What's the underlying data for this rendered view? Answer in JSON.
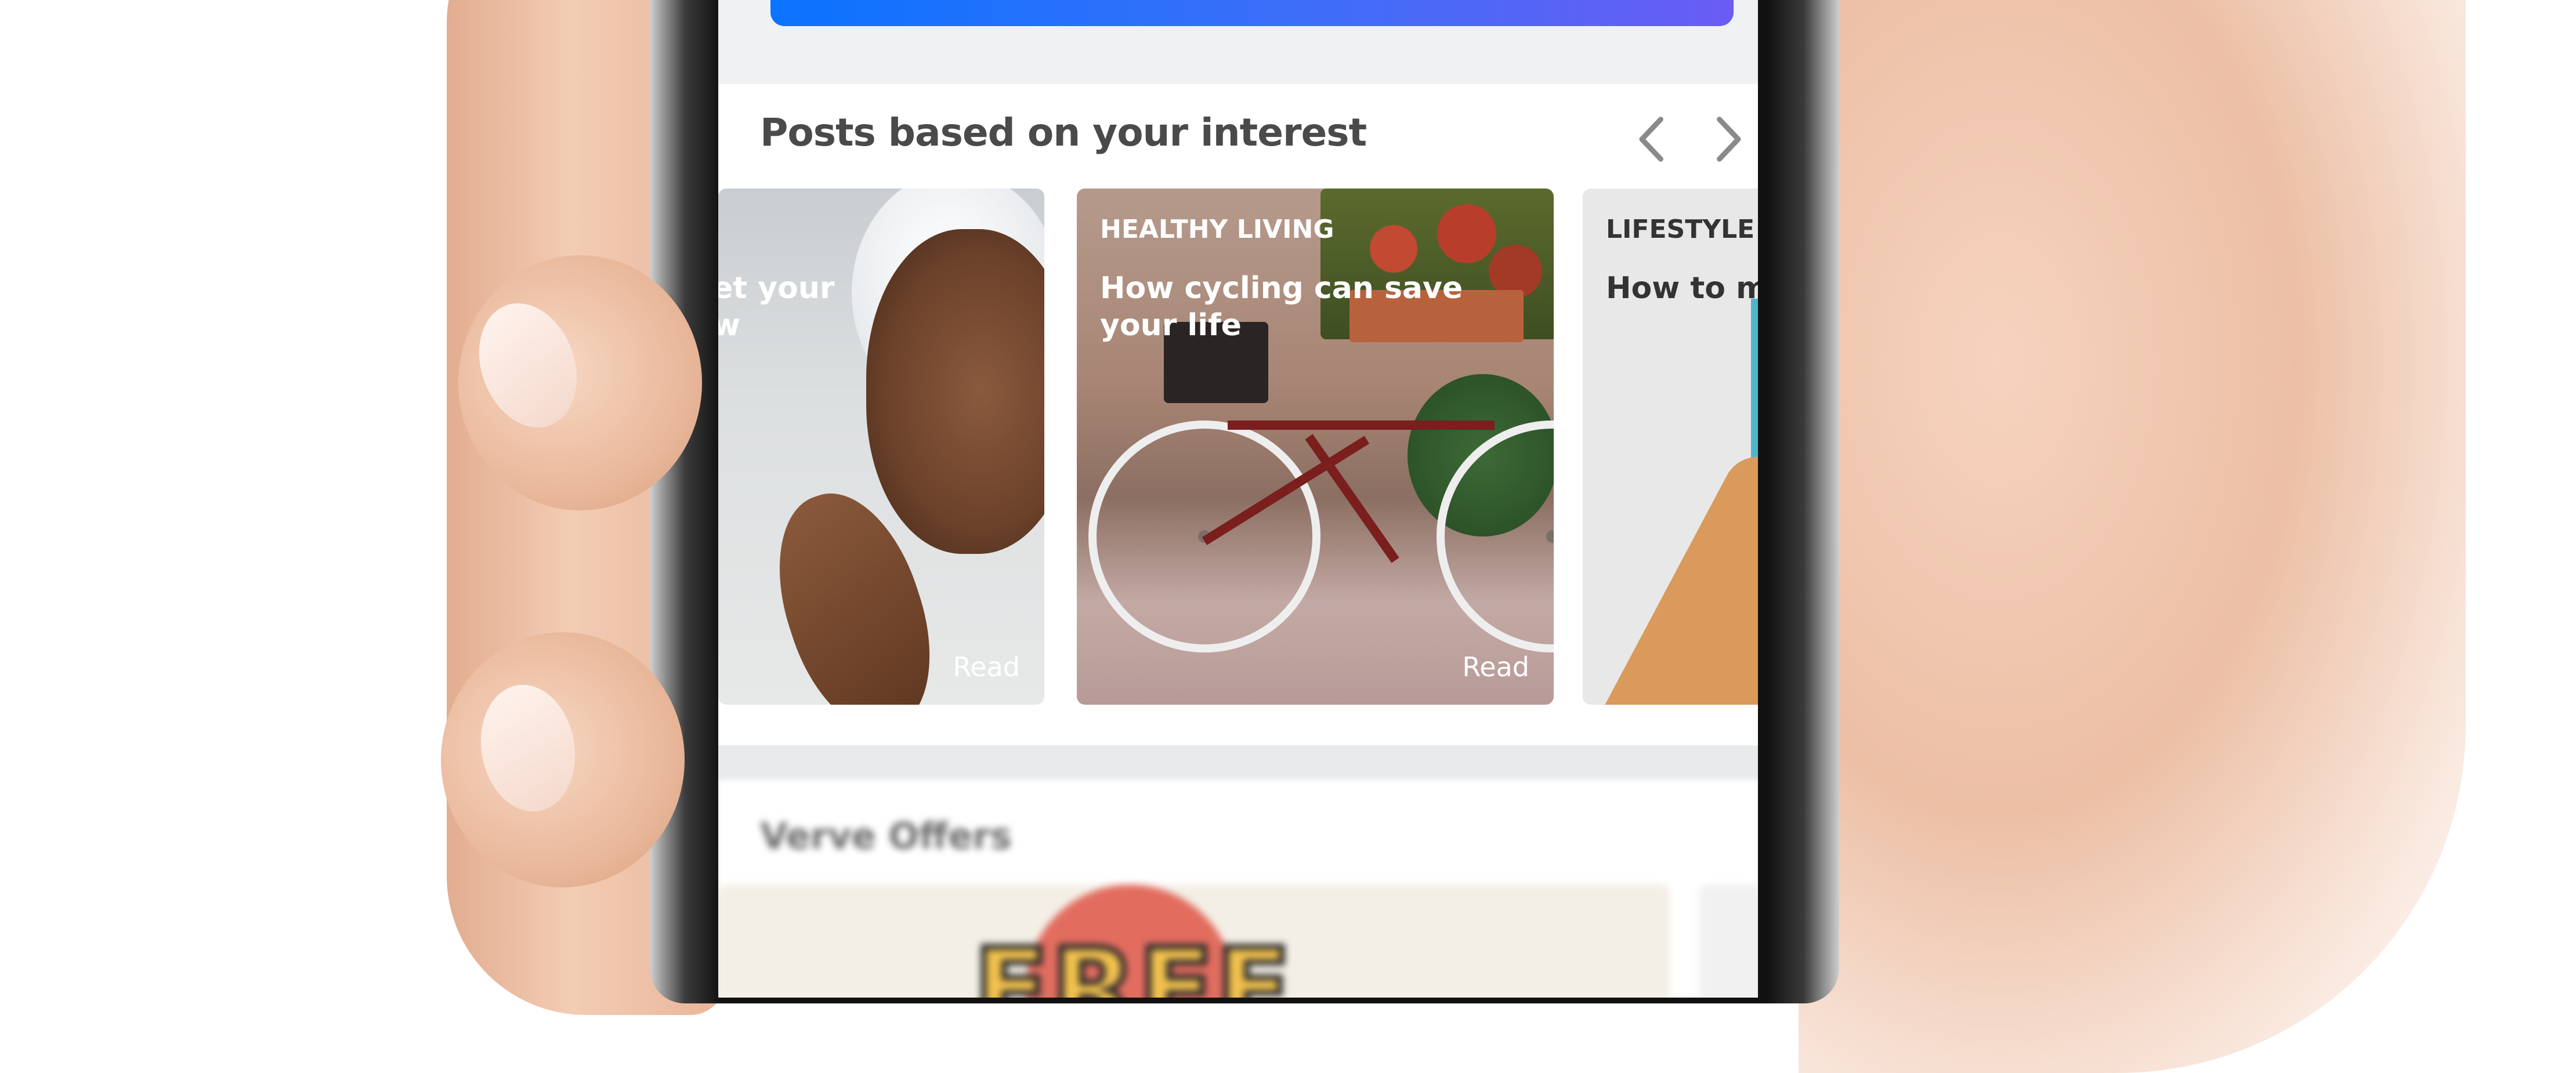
{
  "posts_section": {
    "title": "Posts based on your interest",
    "prev_icon": "chevron-left-icon",
    "next_icon": "chevron-right-icon",
    "posts": [
      {
        "category": "",
        "title": "et your\nw",
        "action": "Read"
      },
      {
        "category": "HEALTHY LIVING",
        "title": "How cycling can save\nyour life",
        "action": "Read"
      },
      {
        "category": "LIFESTYLE",
        "title": "How to mo",
        "action": ""
      }
    ]
  },
  "offers_section": {
    "title": "Verve Offers",
    "banner_text": "FREE"
  },
  "colors": {
    "cta_gradient_start": "#0a73ff",
    "cta_gradient_end": "#6a5cf5",
    "section_title": "#4a4a4a",
    "screen_background": "#f0f1f2"
  }
}
